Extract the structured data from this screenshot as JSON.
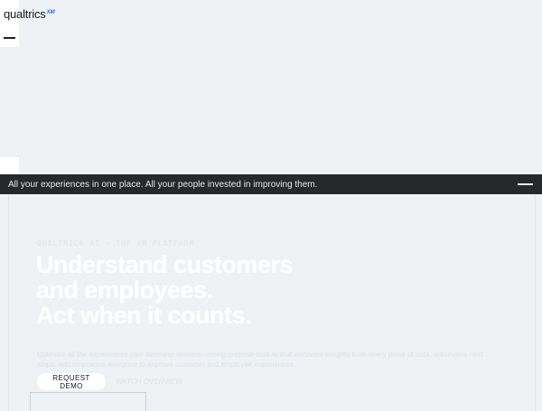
{
  "header": {
    "logo_text": "qualtrics",
    "logo_superscript": "XM",
    "menu_icon": "hamburger-icon"
  },
  "banner": {
    "text": "All your experiences in one place. All your people invested in improving them.",
    "close_icon": "minus-icon"
  },
  "hero": {
    "eyebrow": "QUALTRICS AI + THE XM PLATFORM",
    "headline_lines": [
      "Understand customers",
      "and employees.",
      "Act when it counts."
    ],
    "subcopy": "Optimize all the experiences your business delivers—using purpose-built AI that uncovers insights from every piece of data, automates next steps, and empowers everyone to improve customer and employee experiences.",
    "primary_button": "REQUEST DEMO",
    "secondary_button": "WATCH OVERVIEW"
  },
  "colors": {
    "page_bg": "#eef2f5",
    "banner_bg": "#25292c",
    "logo_accent": "#1b6ce6"
  }
}
